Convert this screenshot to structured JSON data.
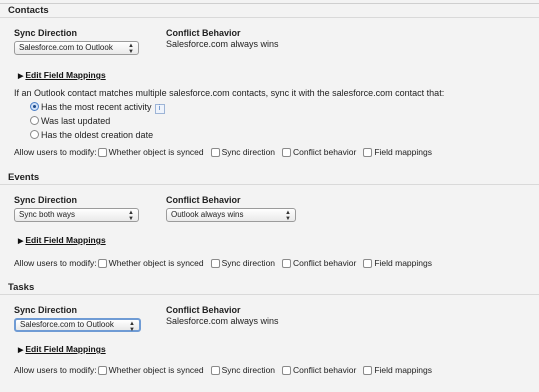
{
  "contacts": {
    "title": "Contacts",
    "sync_direction_label": "Sync Direction",
    "sync_direction_value": "Salesforce.com to Outlook",
    "conflict_behavior_label": "Conflict Behavior",
    "conflict_behavior_value": "Salesforce.com always wins",
    "edit_mappings": "Edit Field Mappings",
    "match_text": "If an Outlook contact matches multiple salesforce.com contacts, sync it with the salesforce.com contact that:",
    "options": [
      "Has the most recent activity",
      "Was last updated",
      "Has the oldest creation date"
    ],
    "selected_option": 0,
    "info_icon": "i",
    "allow_label": "Allow users to modify:",
    "modify_options": [
      "Whether object is synced",
      "Sync direction",
      "Conflict behavior",
      "Field mappings"
    ]
  },
  "events": {
    "title": "Events",
    "sync_direction_label": "Sync Direction",
    "sync_direction_value": "Sync both ways",
    "conflict_behavior_label": "Conflict Behavior",
    "conflict_behavior_value": "Outlook always wins",
    "edit_mappings": "Edit Field Mappings",
    "allow_label": "Allow users to modify:",
    "modify_options": [
      "Whether object is synced",
      "Sync direction",
      "Conflict behavior",
      "Field mappings"
    ]
  },
  "tasks": {
    "title": "Tasks",
    "sync_direction_label": "Sync Direction",
    "sync_direction_value": "Salesforce.com to Outlook",
    "conflict_behavior_label": "Conflict Behavior",
    "conflict_behavior_value": "Salesforce.com always wins",
    "edit_mappings": "Edit Field Mappings",
    "allow_label": "Allow users to modify:",
    "modify_options": [
      "Whether object is synced",
      "Sync direction",
      "Conflict behavior",
      "Field mappings"
    ]
  },
  "icons": {
    "select_arrows": "updown-arrows-icon",
    "expand": "triangle-right-icon"
  }
}
